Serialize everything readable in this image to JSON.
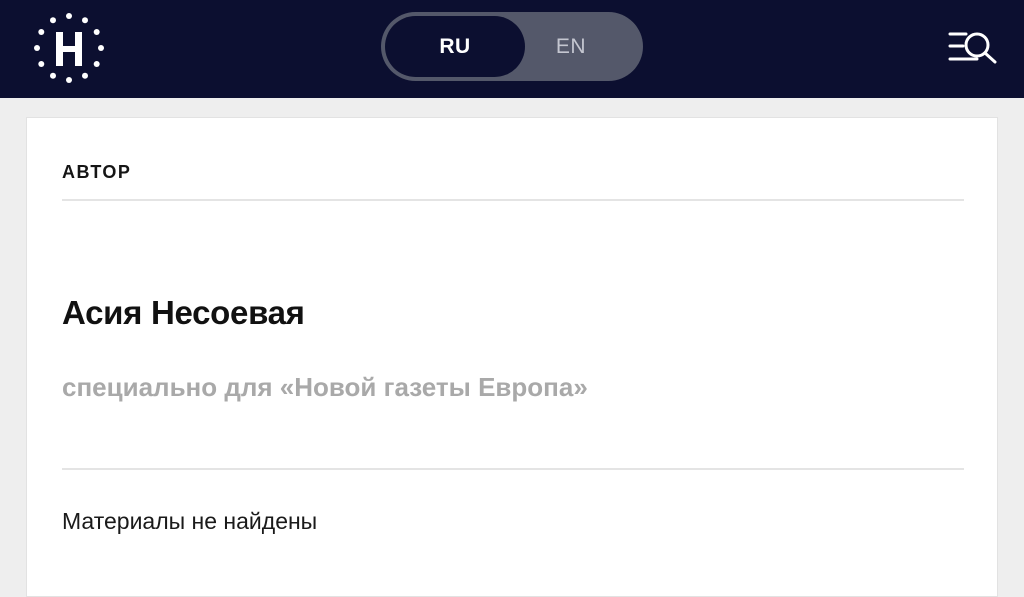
{
  "header": {
    "logo_icon": "dotted-circle-h-logo",
    "languages": [
      {
        "label": "RU",
        "active": true
      },
      {
        "label": "EN",
        "active": false
      }
    ],
    "menu_icon": "menu-search-icon",
    "colors": {
      "bar_background": "#0c0f30",
      "switch_background": "#54586a"
    }
  },
  "author_card": {
    "section_label": "АВТОР",
    "name": "Асия Несоевая",
    "description": "специально для «Новой газеты Европа»",
    "empty_message": "Материалы не найдены"
  }
}
